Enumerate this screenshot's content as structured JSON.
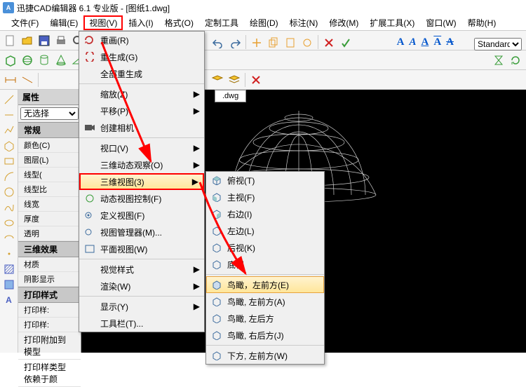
{
  "title": "迅捷CAD编辑器 6.1 专业版  - [图纸1.dwg]",
  "menu": {
    "file": "文件(F)",
    "edit": "编辑(E)",
    "view": "视图(V)",
    "insert": "插入(I)",
    "format": "格式(O)",
    "custom": "定制工具",
    "draw": "绘图(D)",
    "annotate": "标注(N)",
    "modify": "修改(M)",
    "extend": "扩展工具(X)",
    "window": "窗口(W)",
    "help": "帮助(H)"
  },
  "prop": {
    "title": "属性",
    "noselect": "无选择",
    "sections": {
      "general": "常规",
      "fx": "三维效果",
      "print": "打印样式"
    },
    "rows": {
      "color": "颜色(C)",
      "layer": "图层(L)",
      "ltype": "线型(",
      "lscale": "线型比",
      "lweight": "线宽",
      "thick": "厚度",
      "transp": "透明",
      "material": "材质",
      "shadow": "阴影显示",
      "pstyle": "打印样:",
      "pstylet": "打印样:",
      "pattach": "打印附加到",
      "pclass": "打印样类型"
    },
    "vals": {
      "pattach": "模型",
      "pclass": "依赖于颜"
    }
  },
  "tab": ".dwg",
  "style_select": "Standard",
  "viewmenu": {
    "redraw": "重画(R)",
    "regen": "重生成(G)",
    "regenall": "全部重生成",
    "zoom": "缩放(Z)",
    "pan": "平移(P)",
    "camera": "创建相机",
    "viewport": "视口(V)",
    "orbit": "三维动态观察(O)",
    "view3d": "三维视图(3)",
    "dynview": "动态视图控制(F)",
    "defview": "定义视图(F)",
    "viewmgr": "视图管理器(M)...",
    "planview": "平面视图(W)",
    "vstyle": "视觉样式",
    "render": "渲染(W)",
    "display": "显示(Y)",
    "toolbar": "工具栏(T)..."
  },
  "submenu": {
    "top": "俯视(T)",
    "front": "主视(F)",
    "right": "右边(I)",
    "left": "左边(L)",
    "back": "后视(K)",
    "bottom": "底视",
    "bird_fl": "鸟瞰，左前方(E)",
    "bird_fla": "鸟瞰, 左前方(A)",
    "bird_bl": "鸟瞰, 左后方",
    "bird_br": "鸟瞰, 右后方(J)",
    "below_fl": "下方, 左前方(W)"
  }
}
